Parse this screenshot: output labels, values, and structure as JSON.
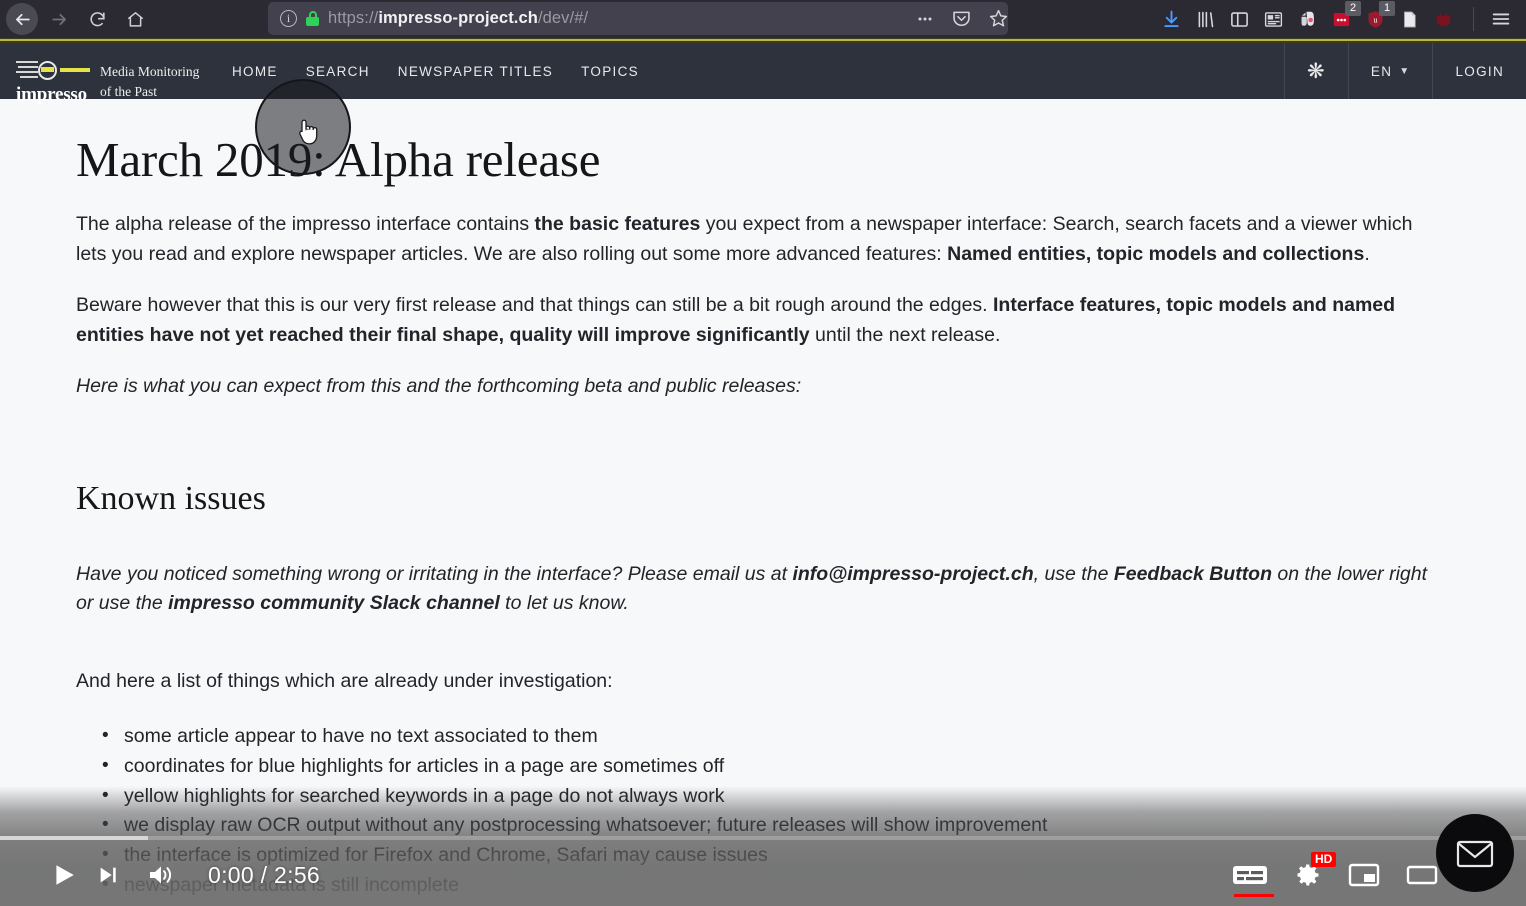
{
  "browser": {
    "nav": {
      "back": "back-arrow",
      "forward": "forward-arrow",
      "reload": "reload-icon",
      "home": "home-icon"
    },
    "url": {
      "scheme": "https://",
      "host": "impresso-project.ch",
      "path": "/dev/#/"
    },
    "toolbar_icons": [
      {
        "name": "page-actions-ellipsis",
        "glyph": "···"
      },
      {
        "name": "pocket-icon",
        "glyph": "pocket"
      },
      {
        "name": "bookmark-star-icon",
        "glyph": "☆"
      },
      {
        "name": "downloads-icon",
        "glyph": "download"
      },
      {
        "name": "library-icon",
        "glyph": "library"
      },
      {
        "name": "sidebar-icon",
        "glyph": "sidebar"
      },
      {
        "name": "reader-extension-icon",
        "glyph": "news"
      },
      {
        "name": "evernote-icon",
        "glyph": "elephant"
      },
      {
        "name": "red-dots-extension-icon",
        "glyph": "dots",
        "badge": "2"
      },
      {
        "name": "shield-extension-icon",
        "glyph": "shield",
        "badge": "1"
      },
      {
        "name": "document-extension-icon",
        "glyph": "doc"
      },
      {
        "name": "dark-extension-icon",
        "glyph": "crown"
      },
      {
        "name": "app-menu-icon",
        "glyph": "☰"
      }
    ]
  },
  "site": {
    "logo": {
      "brand": "impresso",
      "tagline_line1": "Media Monitoring",
      "tagline_line2": "of the Past"
    },
    "nav_links": [
      {
        "id": "home",
        "label": "HOME"
      },
      {
        "id": "search",
        "label": "SEARCH"
      },
      {
        "id": "newspaper-titles",
        "label": "NEWSPAPER TITLES"
      },
      {
        "id": "topics",
        "label": "TOPICS"
      }
    ],
    "nav_right": {
      "settings_icon": "gear-icon",
      "language": "EN",
      "login": "LOGIN"
    }
  },
  "article": {
    "title": "March 2019: Alpha release",
    "p1": {
      "a": "The alpha release of the impresso interface contains ",
      "b1": "the basic features",
      "c": " you expect from a newspaper interface: Search, search facets and a viewer which lets you read and explore newspaper articles. We are also rolling out some more advanced features: ",
      "b2": "Named entities, topic models and collections",
      "d": "."
    },
    "p2": {
      "a": "Beware however that this is our very first release and that things can still be a bit rough around the edges. ",
      "b1": "Interface features, topic models and named entities have not yet reached their final shape, quality will improve significantly",
      "c": " until the next release."
    },
    "p3": "Here is what you can expect from this and the forthcoming beta and public releases:",
    "subtitle": "Known issues",
    "p4": {
      "a": "Have you noticed something wrong or irritating in the interface? Please email us at ",
      "b1": "info@impresso-project.ch",
      "c": ", use the ",
      "b2": "Feedback Button",
      "d": " on the lower right or use the ",
      "b3": "impresso community Slack channel",
      "e": " to let us know."
    },
    "p5": "And here a list of things which are already under investigation:",
    "issues": [
      "some article appear to have no text associated to them",
      "coordinates for blue highlights for articles in a page are sometimes off",
      "yellow highlights for searched keywords in a page do not always work",
      "we display raw OCR output without any postprocessing whatsoever; future releases will show improvement",
      "the interface is optimized for Firefox and Chrome, Safari may cause issues",
      "newspaper metadata is still incomplete"
    ]
  },
  "video_player": {
    "current_time": "0:00",
    "duration": "2:56",
    "time_display": "0:00 / 2:56",
    "controls": {
      "play": "play-icon",
      "next": "next-video-icon",
      "volume": "volume-icon",
      "captions": "subtitles-icon",
      "settings": "settings-gear-icon",
      "quality_badge": "HD",
      "miniplayer": "miniplayer-icon",
      "theater": "theater-mode-icon",
      "fullscreen": "fullscreen-icon"
    },
    "progress_percent": 0
  },
  "overlay": {
    "feedback_button_icon": "envelope-icon",
    "click_target": "SEARCH"
  },
  "colors": {
    "chrome_bg": "#2b2a33",
    "urlbar_bg": "#42414d",
    "site_nav_bg": "#2e323c",
    "page_bg": "#f7f8fa",
    "accent_yellow": "#e4e44a",
    "youtube_red": "#ff0000",
    "lock_green": "#30d158"
  }
}
